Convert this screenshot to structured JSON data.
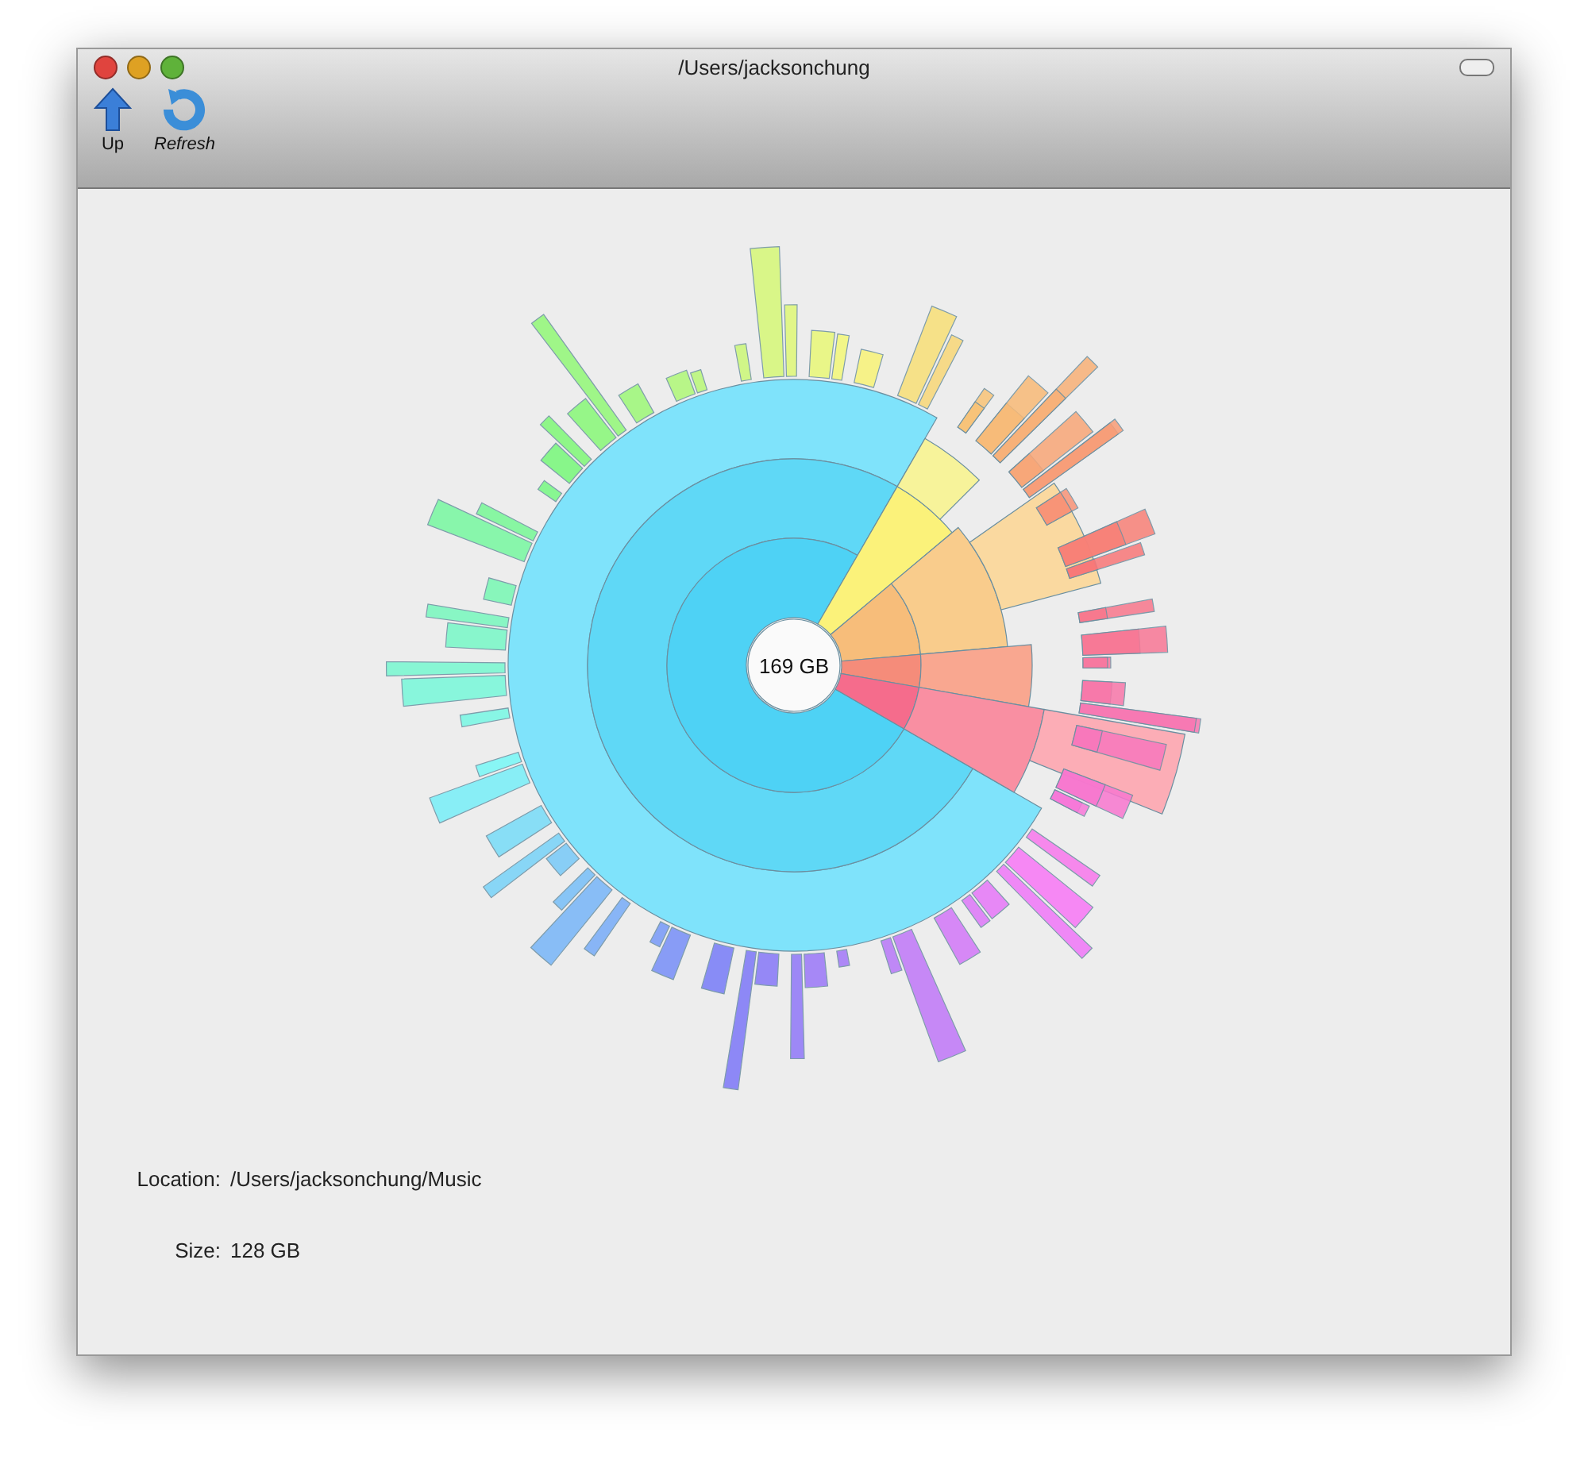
{
  "window": {
    "title": "/Users/jacksonchung"
  },
  "toolbar": [
    {
      "kind": "up",
      "label": "Up"
    },
    {
      "kind": "refresh",
      "label": "Refresh"
    }
  ],
  "sunburst": {
    "center_label": "169 GB"
  },
  "info": [
    {
      "label": "Location:",
      "value": "/Users/jacksonchung/Music"
    },
    {
      "label": "Size:",
      "value": "128 GB"
    }
  ]
}
